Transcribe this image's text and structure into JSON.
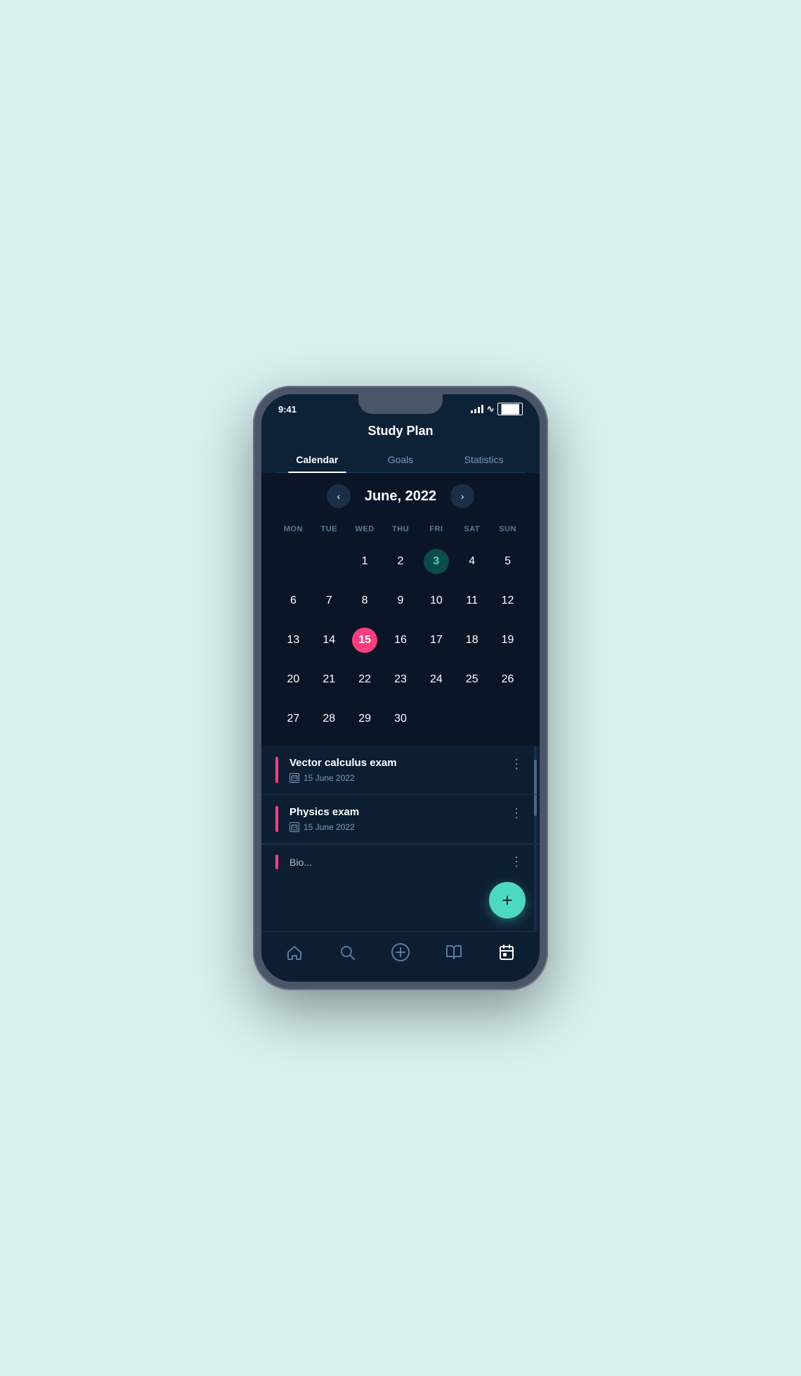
{
  "status_bar": {
    "time": "9:41",
    "signal": "signal",
    "wifi": "wifi",
    "battery": "battery"
  },
  "header": {
    "title": "Study Plan"
  },
  "tabs": [
    {
      "id": "calendar",
      "label": "Calendar",
      "active": true
    },
    {
      "id": "goals",
      "label": "Goals",
      "active": false
    },
    {
      "id": "statistics",
      "label": "Statistics",
      "active": false
    }
  ],
  "calendar": {
    "month_display": "June, 2022",
    "prev_btn": "‹",
    "next_btn": "›",
    "day_headers": [
      "MON",
      "TUE",
      "WED",
      "THU",
      "FRI",
      "SAT",
      "SUN"
    ],
    "days": [
      {
        "num": "",
        "empty": true
      },
      {
        "num": "",
        "empty": true
      },
      {
        "num": "1"
      },
      {
        "num": "2"
      },
      {
        "num": "3",
        "today": true
      },
      {
        "num": "4"
      },
      {
        "num": "5"
      },
      {
        "num": "6"
      },
      {
        "num": "7"
      },
      {
        "num": "8"
      },
      {
        "num": "9"
      },
      {
        "num": "10"
      },
      {
        "num": "11"
      },
      {
        "num": "12"
      },
      {
        "num": "13"
      },
      {
        "num": "14"
      },
      {
        "num": "15",
        "selected": true
      },
      {
        "num": "16"
      },
      {
        "num": "17"
      },
      {
        "num": "18"
      },
      {
        "num": "19"
      },
      {
        "num": "20"
      },
      {
        "num": "21"
      },
      {
        "num": "22"
      },
      {
        "num": "23"
      },
      {
        "num": "24"
      },
      {
        "num": "25"
      },
      {
        "num": "26"
      },
      {
        "num": "27"
      },
      {
        "num": "28"
      },
      {
        "num": "29"
      },
      {
        "num": "30"
      },
      {
        "num": "",
        "empty": true
      },
      {
        "num": "",
        "empty": true
      },
      {
        "num": "",
        "empty": true
      }
    ]
  },
  "events": [
    {
      "title": "Vector calculus exam",
      "date": "15 June 2022"
    },
    {
      "title": "Physics exam",
      "date": "15 June 2022"
    },
    {
      "title": "Bio...",
      "date": "",
      "partial": true
    }
  ],
  "fab_label": "+",
  "bottom_nav": [
    {
      "id": "home",
      "icon": "⌂",
      "label": "home"
    },
    {
      "id": "search",
      "icon": "⌕",
      "label": "search"
    },
    {
      "id": "add",
      "icon": "⊕",
      "label": "add"
    },
    {
      "id": "book",
      "icon": "📖",
      "label": "library"
    },
    {
      "id": "calendar",
      "icon": "📅",
      "label": "calendar",
      "active": true
    }
  ]
}
